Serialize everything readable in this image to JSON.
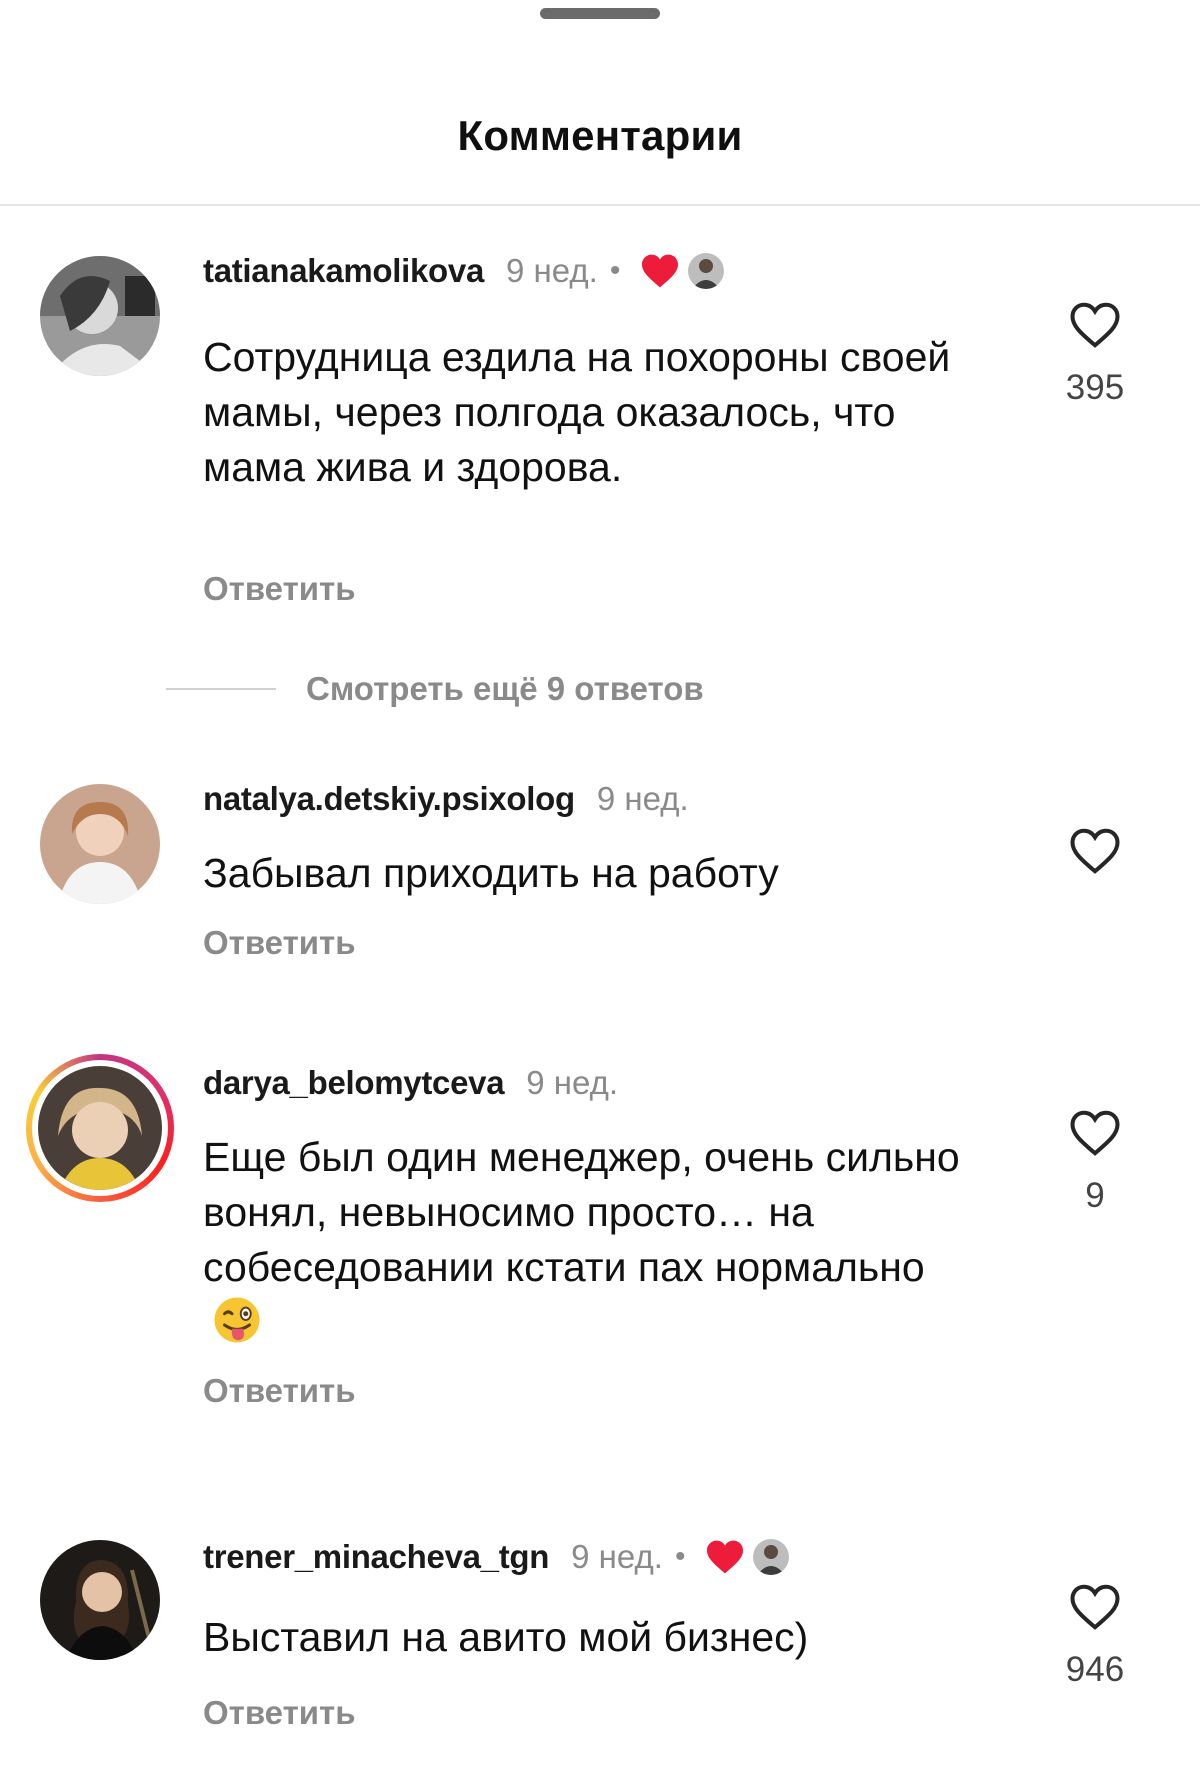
{
  "sheet": {
    "title": "Комментарии"
  },
  "more_replies_label": "Смотреть ещё 9 ответов",
  "comments": [
    {
      "username": "tatianakamolikova",
      "time": "9 нед.",
      "separator": "•",
      "author_liked": true,
      "text": "Сотрудница ездила на похороны своей мамы, через полгода оказалось, что мама жива и здорова.",
      "reply_label": "Ответить",
      "likes": "395"
    },
    {
      "username": "natalya.detskiy.psixolog",
      "time": "9 нед.",
      "author_liked": false,
      "text": "Забывал приходить на работу",
      "reply_label": "Ответить",
      "likes": ""
    },
    {
      "username": "darya_belomytceva",
      "time": "9 нед.",
      "author_liked": false,
      "has_story": true,
      "text": "Еще был один менеджер, очень сильно вонял, невыносимо просто… на собеседовании кстати пах нормально",
      "emoji": "winking-tongue-face",
      "reply_label": "Ответить",
      "likes": "9"
    },
    {
      "username": "trener_minacheva_tgn",
      "time": "9 нед.",
      "separator": "•",
      "author_liked": true,
      "text": "Выставил на авито мой бизнес)",
      "reply_label": "Ответить",
      "likes": "946"
    }
  ],
  "colors": {
    "liked_heart": "#ed1c3a",
    "muted_text": "#8a8a8a",
    "story_ring": "#e1306c"
  }
}
